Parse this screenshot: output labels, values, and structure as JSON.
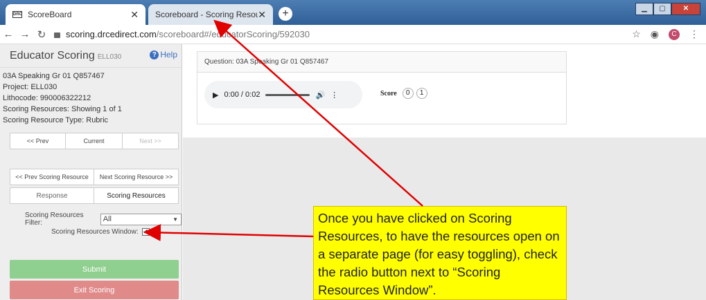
{
  "browser": {
    "tabs": [
      {
        "title": "ScoreBoard",
        "favicon": "DRC"
      },
      {
        "title": "Scoreboard - Scoring Resources"
      }
    ],
    "url_host": "scoring.drcedirect.com",
    "url_path": "/scoreboard#/educatorScoring/592030",
    "avatar_letter": "C"
  },
  "sidebar": {
    "title": "Educator Scoring",
    "subtitle": "ELL030",
    "help_label": "Help",
    "info_lines": [
      "03A Speaking Gr 01 Q857467",
      "Project: ELL030",
      "Lithocode: 990006322212",
      "Scoring Resources: Showing 1 of 1",
      "Scoring Resource Type: Rubric"
    ],
    "nav": {
      "prev": "<< Prev",
      "current": "Current",
      "next": "Next >>"
    },
    "resource_nav": {
      "prev": "<< Prev Scoring Resource",
      "next": "Next Scoring Resource >>"
    },
    "view_tabs": {
      "response": "Response",
      "resources": "Scoring Resources"
    },
    "filter_label": "Scoring Resources Filter:",
    "filter_value": "All",
    "window_label": "Scoring Resources Window:",
    "window_checked": true,
    "submit_label": "Submit",
    "exit_label": "Exit Scoring"
  },
  "main": {
    "question_label": "Question: 03A Speaking Gr 01 Q857467",
    "audio_time": "0:00 / 0:02",
    "score_label": "Score",
    "score_options": [
      "0",
      "1"
    ]
  },
  "callout": {
    "text": "Once you have clicked on Scoring Resources, to have the resources open on a separate page (for easy toggling), check the radio button next to “Scoring Resources Window”."
  },
  "colors": {
    "submit": "#8fcf8f",
    "exit": "#e08a8a",
    "callout_bg": "#ffff00",
    "arrow": "#e00000"
  }
}
